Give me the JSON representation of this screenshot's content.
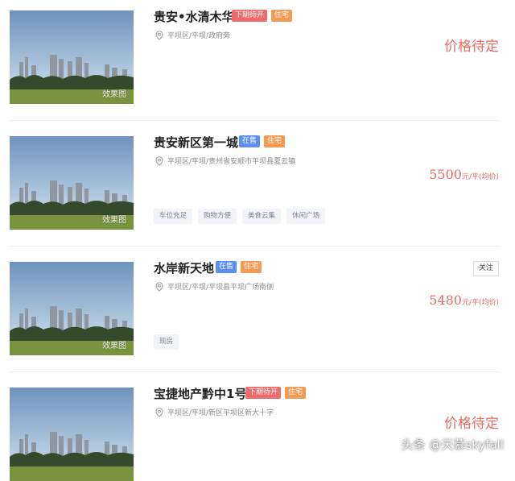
{
  "listings": [
    {
      "title": "贵安•水清木华",
      "badges": [
        "下期待开",
        "住宅"
      ],
      "address": "平坝区/平坝/政府旁",
      "image_caption": "效果图",
      "price_pending": "价格待定",
      "tags": []
    },
    {
      "title": "贵安新区第一城",
      "badges": [
        "在售",
        "住宅"
      ],
      "address": "平坝区/平坝/贵州省安顺市平坝县夏云镇",
      "image_caption": "效果图",
      "price_value": "5500",
      "price_unit": "元/平(均价)",
      "tags": [
        "车位充足",
        "购物方便",
        "美食云集",
        "休闲广场"
      ]
    },
    {
      "title": "水岸新天地",
      "badges": [
        "在售",
        "住宅"
      ],
      "address": "平坝区/平坝/平坝县平坝广场南侧",
      "image_caption": "效果图",
      "follow_label": "关注",
      "price_value": "5480",
      "price_unit": "元/平(均价)",
      "tags": [
        "现房"
      ]
    },
    {
      "title": "宝捷地产黔中1号",
      "badges": [
        "下期待开",
        "住宅"
      ],
      "address": "平坝区/平坝/新区平坝区新大十字",
      "price_pending": "价格待定",
      "tags": []
    }
  ],
  "badge_colors": {
    "下期待开": "#ef6b6b",
    "在售": "#5b8ff0",
    "住宅": "#f39a55"
  },
  "price_color": "#e96a63",
  "watermark_credit": "头条 @天慕skyfall",
  "icons": {
    "address": "location-pin-icon"
  }
}
